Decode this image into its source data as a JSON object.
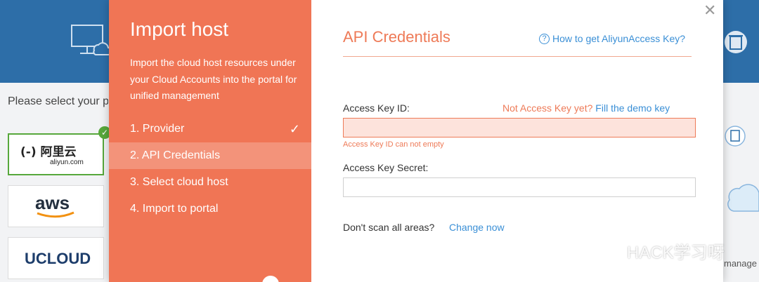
{
  "background": {
    "prompt_text": "Please select your p",
    "providers": [
      {
        "name": "aliyun",
        "logo_main": "(-) 阿里云",
        "logo_sub": "aliyun.com",
        "selected": true
      },
      {
        "name": "aws",
        "logo_main": "aws"
      },
      {
        "name": "ucloud",
        "logo_main": "UCLOUD"
      }
    ],
    "right_text": "manage"
  },
  "sidebar": {
    "title": "Import host",
    "description": "Import the cloud host resources under your Cloud Accounts into the portal for unified management",
    "steps": [
      {
        "label": "1. Provider",
        "done": true
      },
      {
        "label": "2. API Credentials",
        "active": true
      },
      {
        "label": "3. Select cloud host"
      },
      {
        "label": "4. Import to portal"
      }
    ]
  },
  "main": {
    "title": "API Credentials",
    "help_link": "How to get AliyunAccess Key?",
    "access_key_id_label": "Access Key ID:",
    "no_key_text": "Not Access Key yet?",
    "demo_key_link": "Fill the demo key",
    "access_key_id_value": "",
    "access_key_id_error": "Access Key ID can not empty",
    "access_key_secret_label": "Access Key Secret:",
    "access_key_secret_value": "",
    "scan_label": "Don't scan all areas?",
    "scan_link": "Change now"
  },
  "watermark": "HACK学习呀",
  "colors": {
    "accent": "#f07555",
    "link": "#3a8fd6",
    "error_bg": "#fde3dc",
    "header": "#2d6ea8"
  }
}
